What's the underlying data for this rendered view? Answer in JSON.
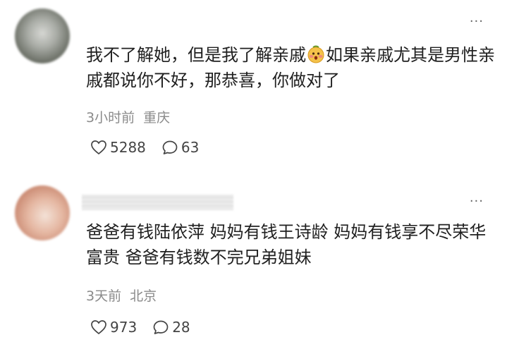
{
  "comments": [
    {
      "menu_glyph": "···",
      "text_before_emoji": "我不了解她，但是我了解亲戚",
      "emoji_icon": "face-emoji",
      "text_after_emoji": "如果亲戚尤其是男性亲戚都说你不好，那恭喜，你做对了",
      "time": "3小时前",
      "location": "重庆",
      "likes": "5288",
      "replies": "63"
    },
    {
      "menu_glyph": "···",
      "text": "爸爸有钱陆依萍 妈妈有钱王诗龄 妈妈有钱享不尽荣华富贵 爸爸有钱数不完兄弟姐妹",
      "time": "3天前",
      "location": "北京",
      "likes": "973",
      "replies": "28"
    }
  ]
}
